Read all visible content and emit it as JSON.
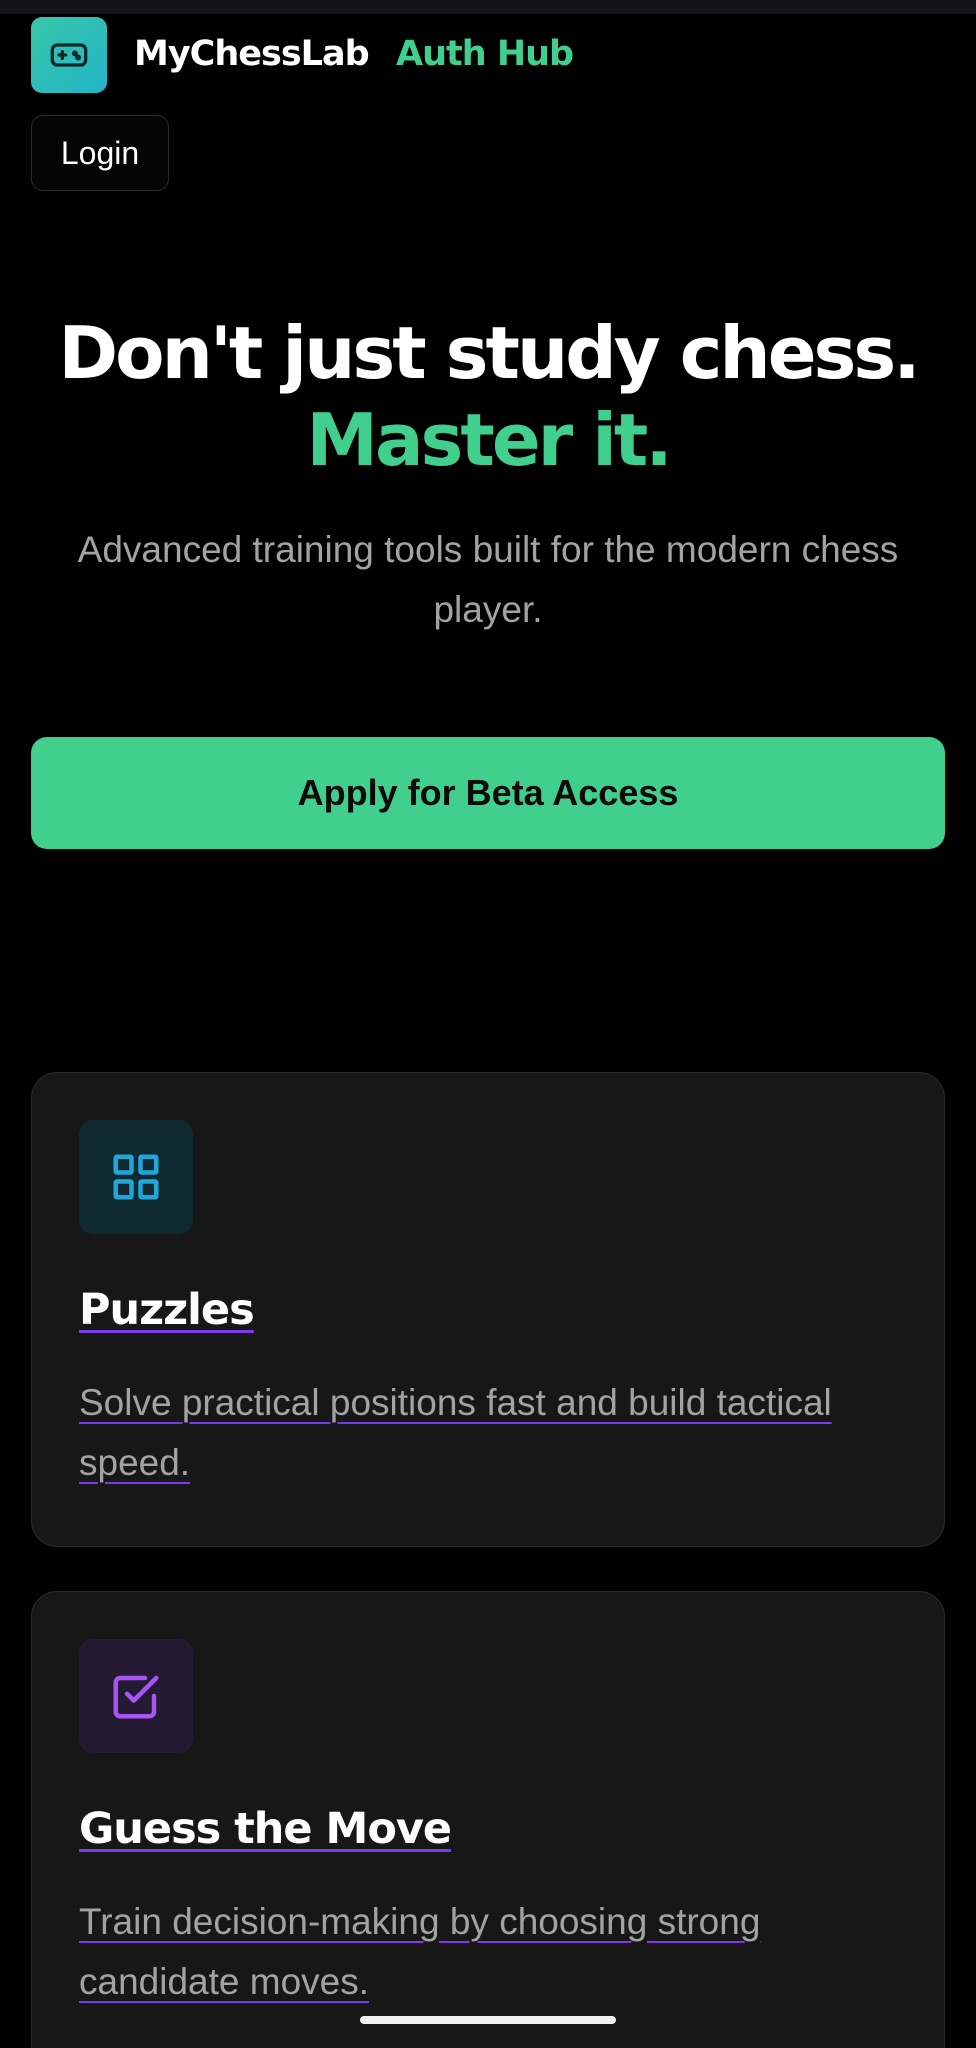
{
  "header": {
    "brand_name": "MyChessLab",
    "brand_sub": "Auth Hub",
    "logo_icon": "gamepad-icon",
    "login_label": "Login"
  },
  "hero": {
    "line1": "Don't just study chess.",
    "line2": "Master it.",
    "subtitle": "Advanced training tools built for the modern chess player.",
    "cta_label": "Apply for Beta Access"
  },
  "features": [
    {
      "icon": "grid-icon",
      "title": "Puzzles",
      "description": "Solve practical positions fast and build tactical speed."
    },
    {
      "icon": "checkbox-icon",
      "title": "Guess the Move",
      "description": "Train decision-making by choosing strong candidate moves."
    }
  ],
  "colors": {
    "background": "#000000",
    "accent": "#41cf8e",
    "card_bg": "#171717",
    "puzzle_icon": "#1ea7d8",
    "guess_icon": "#a855f7",
    "underline": "#7c3aed"
  }
}
